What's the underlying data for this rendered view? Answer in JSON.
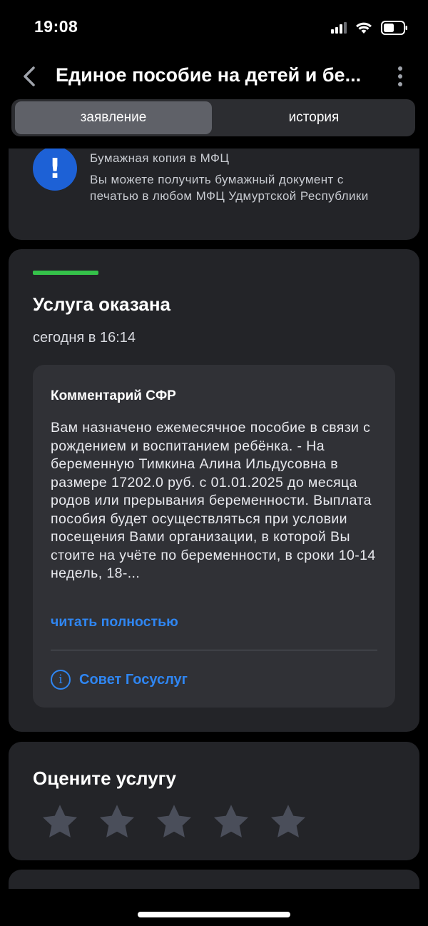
{
  "status_bar": {
    "time": "19:08",
    "icons": [
      "cellular-signal-icon",
      "wifi-icon",
      "battery-icon"
    ]
  },
  "nav": {
    "title": "Единое пособие на детей и бе...",
    "back_icon": "chevron-left-icon",
    "more_icon": "more-vertical-icon"
  },
  "tabs": [
    {
      "label": "заявление",
      "active": true
    },
    {
      "label": "история",
      "active": false
    }
  ],
  "paper_copy": {
    "icon": "exclamation-icon",
    "title": "Бумажная копия в МФЦ",
    "text": "Вы можете получить бумажный документ с печатью в любом МФЦ Удмуртской Республики"
  },
  "status_card": {
    "status": "Услуга оказана",
    "status_color": "#35c24a",
    "date": "сегодня в 16:14",
    "comment": {
      "title": "Комментарий СФР",
      "text": "Вам назначено ежемесячное пособие в связи с рождением и воспитанием ребёнка. - На беременную Тимкина Алина Ильдусовна в размере 17202.0 руб. с 01.01.2025 до месяца родов или прерывания беременности. Выплата пособия будет осуществляться при условии посещения Вами организации, в которой Вы стоите на учёте по беременности, в сроки 10-14 недель, 18-...",
      "read_more": "читать полностью",
      "advice": "Совет Госуслуг"
    }
  },
  "rating": {
    "title": "Оцените услугу",
    "max_stars": 5,
    "selected": 0
  },
  "colors": {
    "background": "#000000",
    "card": "#232428",
    "accent_blue": "#2f86f2",
    "icon_blue": "#1d61d6",
    "star": "#4a4e5a"
  }
}
